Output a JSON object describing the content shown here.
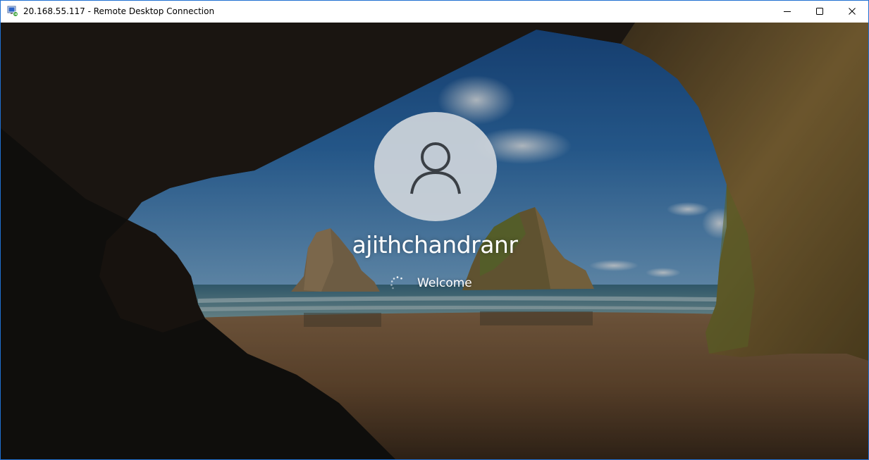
{
  "window": {
    "title": "20.168.55.117 - Remote Desktop Connection",
    "app_icon": "remote-desktop-icon",
    "controls": {
      "minimize_icon": "minimize-icon",
      "maximize_icon": "maximize-icon",
      "close_icon": "close-icon"
    },
    "accent_color": "#1f6fd1"
  },
  "lock_screen": {
    "avatar_icon": "user-icon",
    "username": "ajithchandranr",
    "status": "Welcome",
    "spinner_icon": "loading-spinner-icon",
    "background": "sea-cave-beach-wallpaper"
  }
}
